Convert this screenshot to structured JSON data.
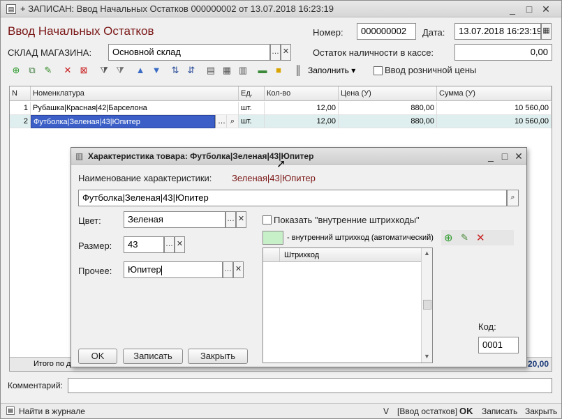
{
  "window": {
    "title": "+ ЗАПИСАН: Ввод Начальных Остатков 000000002 от 13.07.2018 16:23:19",
    "minimize": "_",
    "maximize": "□",
    "close": "✕"
  },
  "form": {
    "heading": "Ввод Начальных Остатков",
    "number_label": "Номер:",
    "number_value": "000000002",
    "date_label": "Дата:",
    "date_value": "13.07.2018 16:23:19",
    "warehouse_label": "СКЛАД МАГАЗИНА:",
    "warehouse_value": "Основной склад",
    "cash_label": "Остаток наличности в кассе:",
    "cash_value": "0,00",
    "fill_label": "Заполнить",
    "retail_price_label": "Ввод розничной цены"
  },
  "grid": {
    "columns": [
      "N",
      "Номенклатура",
      "Ед.",
      "Кол-во",
      "Цена (У)",
      "Сумма (У)"
    ],
    "rows": [
      {
        "n": "1",
        "item": "Рубашка|Красная|42|Барселона",
        "unit": "шт.",
        "qty": "12,00",
        "price": "880,00",
        "sum": "10 560,00"
      },
      {
        "n": "2",
        "item": "Футболка|Зеленая|43|Юпитер",
        "unit": "шт.",
        "qty": "12,00",
        "price": "880,00",
        "sum": "10 560,00"
      }
    ],
    "footer_label": "Итого по д",
    "footer_total": "20,00"
  },
  "comment_label": "Комментарий:",
  "status": {
    "journal": "Найти в журнале",
    "v": "V",
    "mode": "[Ввод остатков]",
    "ok": "OK",
    "save": "Записать",
    "close": "Закрыть"
  },
  "dialog": {
    "title": "Характеристика товара: Футболка|Зеленая|43|Юпитер",
    "name_label": "Наименование характеристики:",
    "name_value": "Зеленая|43|Юпитер",
    "full_name": "Футболка|Зеленая|43|Юпитер",
    "color_label": "Цвет:",
    "color_value": "Зеленая",
    "size_label": "Размер:",
    "size_value": "43",
    "other_label": "Прочее:",
    "other_value": "Юпитер",
    "show_internal_label": "Показать \"внутренние штрихкоды\"",
    "internal_barcode_label": "- внутренний штрихкод (автоматический)",
    "barcode_column": "Штрихкод",
    "code_label": "Код:",
    "code_value": "0001",
    "ok": "OK",
    "save": "Записать",
    "close": "Закрыть"
  },
  "colors": {
    "heading": "#7a1515",
    "selected_row": "#3b5fc7",
    "internal_barcode_swatch": "#c8f0c8"
  }
}
